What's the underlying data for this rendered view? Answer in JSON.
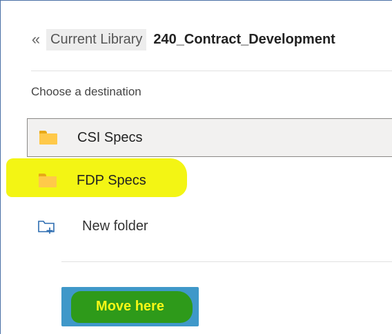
{
  "breadcrumb": {
    "back_icon": "double-chevron-left-icon",
    "current_library_label": "Current Library",
    "current_folder_label": "240_Contract_Development"
  },
  "destination": {
    "heading": "Choose a destination",
    "folders": [
      {
        "label": "CSI Specs",
        "icon": "folder-icon",
        "selected": true
      },
      {
        "label": "FDP Specs",
        "icon": "folder-icon",
        "selected": false,
        "highlighted": true
      }
    ],
    "new_folder": {
      "label": "New folder",
      "icon": "new-folder-icon"
    }
  },
  "actions": {
    "move_here_label": "Move here"
  },
  "colors": {
    "frame_border": "#4a6fa5",
    "selected_row_bg": "#f2f1f0",
    "highlight_yellow": "#f3f514",
    "button_blue": "#3f98c9",
    "highlight_green": "#2e9a1a",
    "folder_yellow": "#ffc94a"
  }
}
